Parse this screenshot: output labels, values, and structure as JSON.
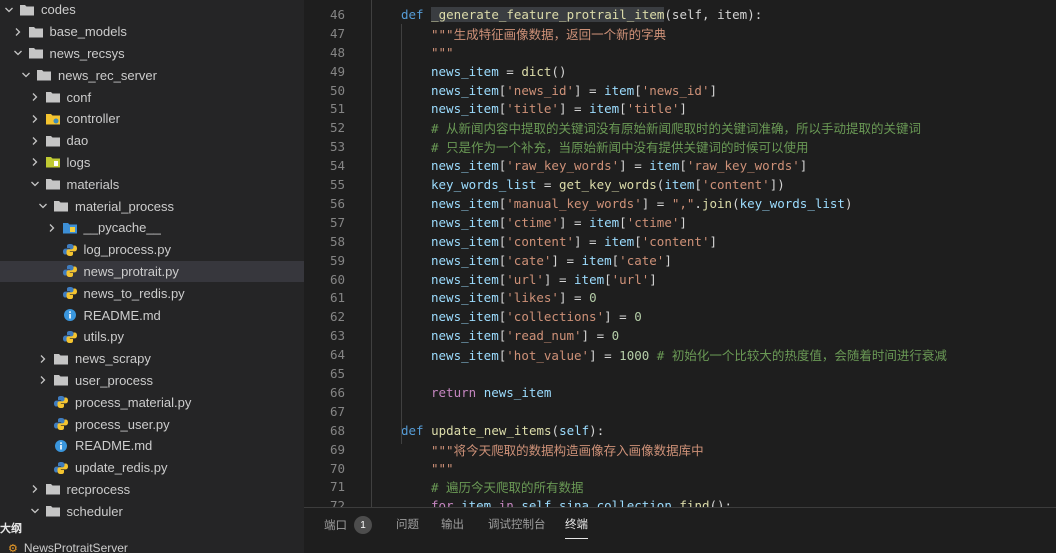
{
  "explorer": {
    "items": [
      {
        "label": "codes",
        "depth": 0,
        "type": "folder",
        "expanded": true
      },
      {
        "label": "base_models",
        "depth": 1,
        "type": "folder",
        "expanded": false
      },
      {
        "label": "news_recsys",
        "depth": 1,
        "type": "folder",
        "expanded": true
      },
      {
        "label": "news_rec_server",
        "depth": 2,
        "type": "folder",
        "expanded": true
      },
      {
        "label": "conf",
        "depth": 3,
        "type": "folder",
        "expanded": false
      },
      {
        "label": "controller",
        "depth": 3,
        "type": "folder-special",
        "expanded": false
      },
      {
        "label": "dao",
        "depth": 3,
        "type": "folder",
        "expanded": false
      },
      {
        "label": "logs",
        "depth": 3,
        "type": "folder-logs",
        "expanded": false
      },
      {
        "label": "materials",
        "depth": 3,
        "type": "folder",
        "expanded": true
      },
      {
        "label": "material_process",
        "depth": 4,
        "type": "folder",
        "expanded": true
      },
      {
        "label": "__pycache__",
        "depth": 5,
        "type": "folder-pycache",
        "expanded": false
      },
      {
        "label": "log_process.py",
        "depth": 5,
        "type": "python"
      },
      {
        "label": "news_protrait.py",
        "depth": 5,
        "type": "python",
        "selected": true
      },
      {
        "label": "news_to_redis.py",
        "depth": 5,
        "type": "python"
      },
      {
        "label": "README.md",
        "depth": 5,
        "type": "info"
      },
      {
        "label": "utils.py",
        "depth": 5,
        "type": "python"
      },
      {
        "label": "news_scrapy",
        "depth": 4,
        "type": "folder",
        "expanded": false
      },
      {
        "label": "user_process",
        "depth": 4,
        "type": "folder",
        "expanded": false
      },
      {
        "label": "process_material.py",
        "depth": 4,
        "type": "python"
      },
      {
        "label": "process_user.py",
        "depth": 4,
        "type": "python"
      },
      {
        "label": "README.md",
        "depth": 4,
        "type": "info"
      },
      {
        "label": "update_redis.py",
        "depth": 4,
        "type": "python"
      },
      {
        "label": "recprocess",
        "depth": 3,
        "type": "folder",
        "expanded": false
      },
      {
        "label": "scheduler",
        "depth": 3,
        "type": "folder",
        "expanded": true
      }
    ],
    "outline_title": "大纲",
    "outline_item": "NewsProtraitServer"
  },
  "editor": {
    "lines": [
      {
        "n": "46",
        "indent": 1,
        "tokens": [
          [
            "kw",
            "def "
          ],
          [
            "hl",
            "_generate_feature_protrail_item"
          ],
          [
            "",
            "(self, item):"
          ]
        ]
      },
      {
        "n": "47",
        "indent": 2,
        "tokens": [
          [
            "str",
            "\"\"\"生成特征画像数据，返回一个新的字典"
          ]
        ]
      },
      {
        "n": "48",
        "indent": 2,
        "tokens": [
          [
            "str",
            "\"\"\""
          ]
        ]
      },
      {
        "n": "49",
        "indent": 2,
        "tokens": [
          [
            "var",
            "news_item"
          ],
          [
            "",
            " = "
          ],
          [
            "fn",
            "dict"
          ],
          [
            "",
            "()"
          ]
        ]
      },
      {
        "n": "50",
        "indent": 2,
        "tokens": [
          [
            "var",
            "news_item"
          ],
          [
            "",
            "["
          ],
          [
            "str",
            "'news_id'"
          ],
          [
            "",
            "] = "
          ],
          [
            "var",
            "item"
          ],
          [
            "",
            "["
          ],
          [
            "str",
            "'news_id'"
          ],
          [
            "",
            "]"
          ]
        ]
      },
      {
        "n": "51",
        "indent": 2,
        "tokens": [
          [
            "var",
            "news_item"
          ],
          [
            "",
            "["
          ],
          [
            "str",
            "'title'"
          ],
          [
            "",
            "] = "
          ],
          [
            "var",
            "item"
          ],
          [
            "",
            "["
          ],
          [
            "str",
            "'title'"
          ],
          [
            "",
            "]"
          ]
        ]
      },
      {
        "n": "52",
        "indent": 2,
        "tokens": [
          [
            "cmt",
            "# 从新闻内容中提取的关键词没有原始新闻爬取时的关键词准确，所以手动提取的关键词"
          ]
        ]
      },
      {
        "n": "53",
        "indent": 2,
        "tokens": [
          [
            "cmt",
            "# 只是作为一个补充，当原始新闻中没有提供关键词的时候可以使用"
          ]
        ]
      },
      {
        "n": "54",
        "indent": 2,
        "tokens": [
          [
            "var",
            "news_item"
          ],
          [
            "",
            "["
          ],
          [
            "str",
            "'raw_key_words'"
          ],
          [
            "",
            "] = "
          ],
          [
            "var",
            "item"
          ],
          [
            "",
            "["
          ],
          [
            "str",
            "'raw_key_words'"
          ],
          [
            "",
            "]"
          ]
        ]
      },
      {
        "n": "55",
        "indent": 2,
        "tokens": [
          [
            "var",
            "key_words_list"
          ],
          [
            "",
            " = "
          ],
          [
            "fn",
            "get_key_words"
          ],
          [
            "",
            "("
          ],
          [
            "var",
            "item"
          ],
          [
            "",
            "["
          ],
          [
            "str",
            "'content'"
          ],
          [
            "",
            "])"
          ]
        ]
      },
      {
        "n": "56",
        "indent": 2,
        "tokens": [
          [
            "var",
            "news_item"
          ],
          [
            "",
            "["
          ],
          [
            "str",
            "'manual_key_words'"
          ],
          [
            "",
            "] = "
          ],
          [
            "str",
            "\",\""
          ],
          [
            "",
            "."
          ],
          [
            "fn",
            "join"
          ],
          [
            "",
            "("
          ],
          [
            "var",
            "key_words_list"
          ],
          [
            "",
            ")"
          ]
        ]
      },
      {
        "n": "57",
        "indent": 2,
        "tokens": [
          [
            "var",
            "news_item"
          ],
          [
            "",
            "["
          ],
          [
            "str",
            "'ctime'"
          ],
          [
            "",
            "] = "
          ],
          [
            "var",
            "item"
          ],
          [
            "",
            "["
          ],
          [
            "str",
            "'ctime'"
          ],
          [
            "",
            "]"
          ]
        ]
      },
      {
        "n": "58",
        "indent": 2,
        "tokens": [
          [
            "var",
            "news_item"
          ],
          [
            "",
            "["
          ],
          [
            "str",
            "'content'"
          ],
          [
            "",
            "] = "
          ],
          [
            "var",
            "item"
          ],
          [
            "",
            "["
          ],
          [
            "str",
            "'content'"
          ],
          [
            "",
            "]"
          ]
        ]
      },
      {
        "n": "59",
        "indent": 2,
        "tokens": [
          [
            "var",
            "news_item"
          ],
          [
            "",
            "["
          ],
          [
            "str",
            "'cate'"
          ],
          [
            "",
            "] = "
          ],
          [
            "var",
            "item"
          ],
          [
            "",
            "["
          ],
          [
            "str",
            "'cate'"
          ],
          [
            "",
            "]"
          ]
        ]
      },
      {
        "n": "60",
        "indent": 2,
        "tokens": [
          [
            "var",
            "news_item"
          ],
          [
            "",
            "["
          ],
          [
            "str",
            "'url'"
          ],
          [
            "",
            "] = "
          ],
          [
            "var",
            "item"
          ],
          [
            "",
            "["
          ],
          [
            "str",
            "'url'"
          ],
          [
            "",
            "]"
          ]
        ]
      },
      {
        "n": "61",
        "indent": 2,
        "tokens": [
          [
            "var",
            "news_item"
          ],
          [
            "",
            "["
          ],
          [
            "str",
            "'likes'"
          ],
          [
            "",
            "] = "
          ],
          [
            "num",
            "0"
          ]
        ]
      },
      {
        "n": "62",
        "indent": 2,
        "tokens": [
          [
            "var",
            "news_item"
          ],
          [
            "",
            "["
          ],
          [
            "str",
            "'collections'"
          ],
          [
            "",
            "] = "
          ],
          [
            "num",
            "0"
          ]
        ]
      },
      {
        "n": "63",
        "indent": 2,
        "tokens": [
          [
            "var",
            "news_item"
          ],
          [
            "",
            "["
          ],
          [
            "str",
            "'read_num'"
          ],
          [
            "",
            "] = "
          ],
          [
            "num",
            "0"
          ]
        ]
      },
      {
        "n": "64",
        "indent": 2,
        "tokens": [
          [
            "var",
            "news_item"
          ],
          [
            "",
            "["
          ],
          [
            "str",
            "'hot_value'"
          ],
          [
            "",
            "] = "
          ],
          [
            "num",
            "1000"
          ],
          [
            "cmt",
            " # 初始化一个比较大的热度值，会随着时间进行衰减"
          ]
        ]
      },
      {
        "n": "65",
        "indent": 2,
        "tokens": []
      },
      {
        "n": "66",
        "indent": 2,
        "tokens": [
          [
            "ctl",
            "return "
          ],
          [
            "var",
            "news_item"
          ]
        ]
      },
      {
        "n": "67",
        "indent": 1,
        "tokens": []
      },
      {
        "n": "68",
        "indent": 1,
        "tokens": [
          [
            "kw",
            "def "
          ],
          [
            "fn",
            "update_new_items"
          ],
          [
            "",
            "("
          ],
          [
            "var",
            "self"
          ],
          [
            "",
            "):"
          ]
        ]
      },
      {
        "n": "69",
        "indent": 2,
        "tokens": [
          [
            "str",
            "\"\"\"将今天爬取的数据构造画像存入画像数据库中"
          ]
        ]
      },
      {
        "n": "70",
        "indent": 2,
        "tokens": [
          [
            "str",
            "\"\"\""
          ]
        ]
      },
      {
        "n": "71",
        "indent": 2,
        "tokens": [
          [
            "cmt",
            "# 遍历今天爬取的所有数据"
          ]
        ]
      },
      {
        "n": "72",
        "indent": 2,
        "tokens": [
          [
            "ctl",
            "for "
          ],
          [
            "var",
            "item"
          ],
          [
            "ctl",
            " in "
          ],
          [
            "var",
            "self"
          ],
          [
            "",
            "."
          ],
          [
            "var",
            "sina_collection"
          ],
          [
            "",
            "."
          ],
          [
            "fn",
            "find"
          ],
          [
            "",
            "():"
          ]
        ]
      }
    ]
  },
  "panel": {
    "tabs": [
      {
        "label": "端口",
        "badge": "1"
      },
      {
        "label": "问题"
      },
      {
        "label": "输出"
      },
      {
        "label": "调试控制台"
      },
      {
        "label": "终端",
        "active": true
      }
    ]
  },
  "colors": {
    "background": "#1e1e1e",
    "sidebar": "#252526",
    "selection": "#37373d",
    "keyword": "#569cd6",
    "string": "#ce9178",
    "comment": "#6a9955",
    "function": "#dcdcaa",
    "variable": "#9cdcfe",
    "number": "#b5cea8"
  }
}
